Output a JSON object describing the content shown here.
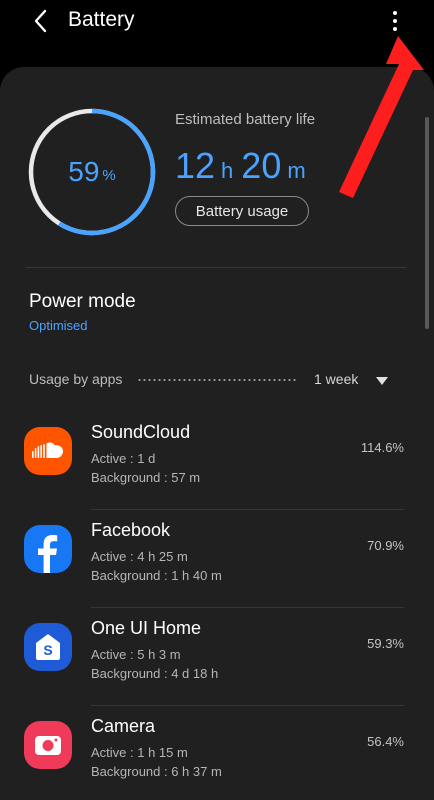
{
  "header": {
    "title": "Battery",
    "back_icon": "chevron-left-icon",
    "more_icon": "more-vertical-icon"
  },
  "battery": {
    "percent": 59,
    "percent_value": "59",
    "percent_unit": "%",
    "estimated_label": "Estimated battery life",
    "hours": "12",
    "hours_unit": "h",
    "minutes": "20",
    "minutes_unit": "m",
    "usage_button": "Battery usage",
    "accent_color": "#4aa3ff"
  },
  "power_mode": {
    "title": "Power mode",
    "value": "Optimised"
  },
  "usage_by_apps": {
    "label": "Usage by apps",
    "period": "1 week",
    "apps": [
      {
        "name": "SoundCloud",
        "active": "Active : 1 d",
        "background": "Background : 57 m",
        "percent": "114.6%",
        "icon": "soundcloud-icon",
        "color": "#ff5500"
      },
      {
        "name": "Facebook",
        "active": "Active : 4 h 25 m",
        "background": "Background : 1 h 40 m",
        "percent": "70.9%",
        "icon": "facebook-icon",
        "color": "#1877f2"
      },
      {
        "name": "One UI Home",
        "active": "Active : 5 h 3 m",
        "background": "Background : 4 d 18 h",
        "percent": "59.3%",
        "icon": "one-ui-home-icon",
        "color": "#1f5bd6"
      },
      {
        "name": "Camera",
        "active": "Active : 1 h 15 m",
        "background": "Background : 6 h 37 m",
        "percent": "56.4%",
        "icon": "camera-icon",
        "color": "#f03a5a"
      }
    ]
  },
  "annotation": {
    "arrow_color": "#ff1e1e"
  }
}
